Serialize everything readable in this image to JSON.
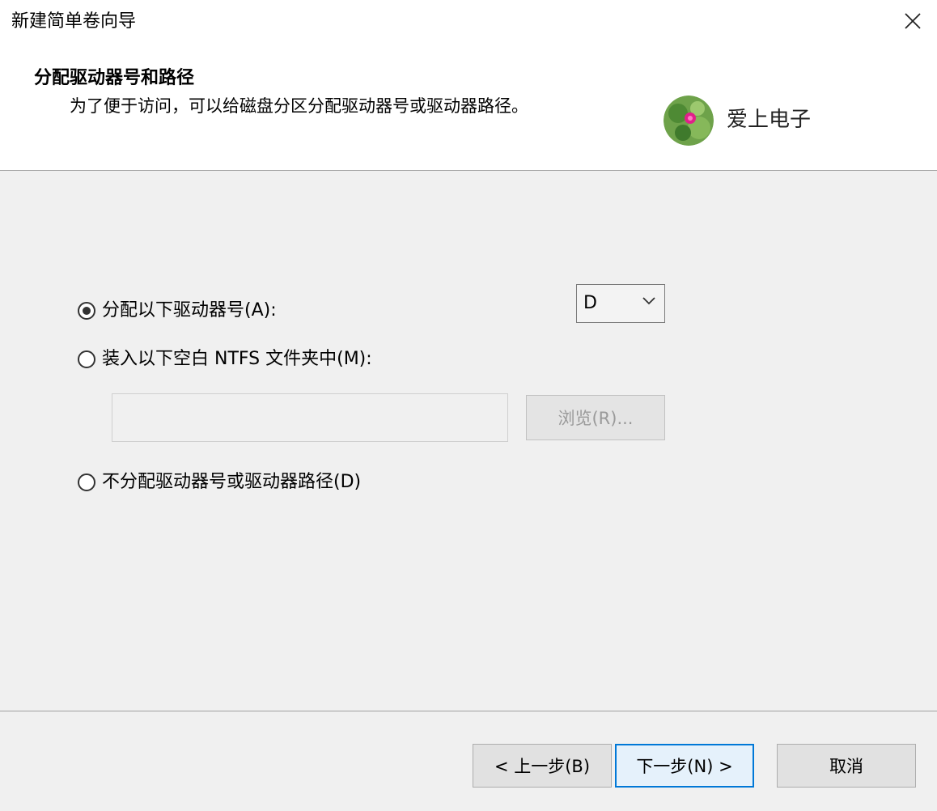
{
  "window": {
    "title": "新建简单卷向导"
  },
  "header": {
    "title": "分配驱动器号和路径",
    "subtitle": "为了便于访问，可以给磁盘分区分配驱动器号或驱动器路径。",
    "brand": "爱上电子"
  },
  "options": {
    "assign_letter": {
      "label": "分配以下驱动器号(A):",
      "selected": true
    },
    "mount_folder": {
      "label": "装入以下空白 NTFS 文件夹中(M):",
      "selected": false
    },
    "no_assign": {
      "label": "不分配驱动器号或驱动器路径(D)",
      "selected": false
    }
  },
  "drive_select": {
    "value": "D"
  },
  "path_input": {
    "value": ""
  },
  "browse": {
    "label": "浏览(R)..."
  },
  "buttons": {
    "back": "< 上一步(B)",
    "next": "下一步(N) >",
    "cancel": "取消"
  },
  "colors": {
    "accent": "#0078d7",
    "background": "#f0f0f0",
    "header_bg": "#ffffff"
  }
}
